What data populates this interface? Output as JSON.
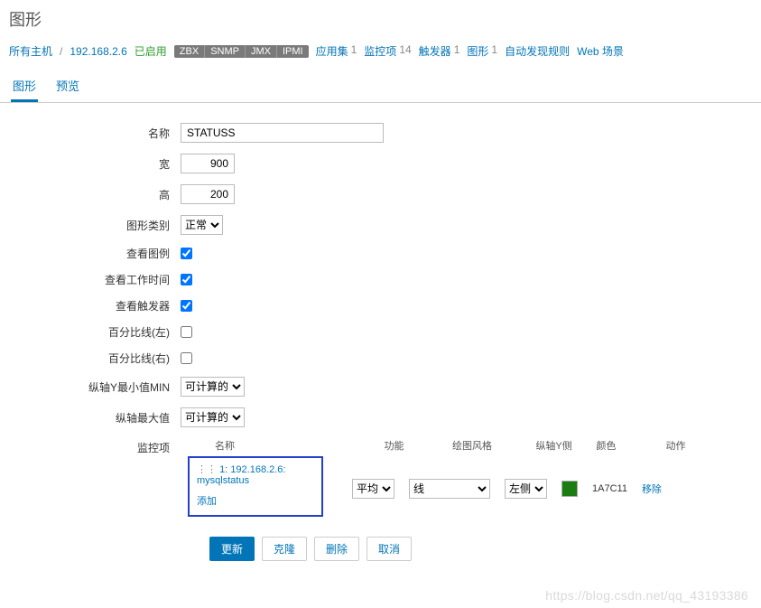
{
  "page_title": "图形",
  "breadcrumb": {
    "all_hosts": "所有主机",
    "separator": "/",
    "host_ip": "192.168.2.6",
    "enabled": "已启用"
  },
  "tags": [
    "ZBX",
    "SNMP",
    "JMX",
    "IPMI"
  ],
  "stats": {
    "apps": {
      "label": "应用集",
      "count": "1"
    },
    "items": {
      "label": "监控项",
      "count": "14"
    },
    "triggers": {
      "label": "触发器",
      "count": "1"
    },
    "graphs": {
      "label": "图形",
      "count": "1"
    },
    "discovery": {
      "label": "自动发现规则"
    },
    "web": {
      "label": "Web 场景"
    }
  },
  "tabs": {
    "graph": "图形",
    "preview": "预览"
  },
  "form": {
    "name": {
      "label": "名称",
      "value": "STATUSS"
    },
    "width": {
      "label": "宽",
      "value": "900"
    },
    "height": {
      "label": "高",
      "value": "200"
    },
    "graph_type": {
      "label": "图形类别",
      "value": "正常"
    },
    "show_legend": {
      "label": "查看图例"
    },
    "show_working_time": {
      "label": "查看工作时间"
    },
    "show_triggers": {
      "label": "查看触发器"
    },
    "percent_left": {
      "label": "百分比线(左)"
    },
    "percent_right": {
      "label": "百分比线(右)"
    },
    "y_min": {
      "label": "纵轴Y最小值MIN",
      "value": "可计算的"
    },
    "y_max": {
      "label": "纵轴最大值",
      "value": "可计算的"
    },
    "items": {
      "label": "监控项",
      "headers": {
        "name": "名称",
        "func": "功能",
        "drawstyle": "绘图风格",
        "yaxis": "纵轴Y侧",
        "color": "颜色",
        "action": "动作"
      },
      "row": {
        "idx": "1:",
        "host": "192.168.2.6:",
        "key": "mysqlstatus",
        "func": "平均",
        "draw": "线",
        "yaxis": "左侧",
        "color": "1A7C11",
        "remove": "移除"
      },
      "add": "添加"
    }
  },
  "buttons": {
    "update": "更新",
    "clone": "克隆",
    "delete": "删除",
    "cancel": "取消"
  },
  "watermark": "https://blog.csdn.net/qq_43193386"
}
